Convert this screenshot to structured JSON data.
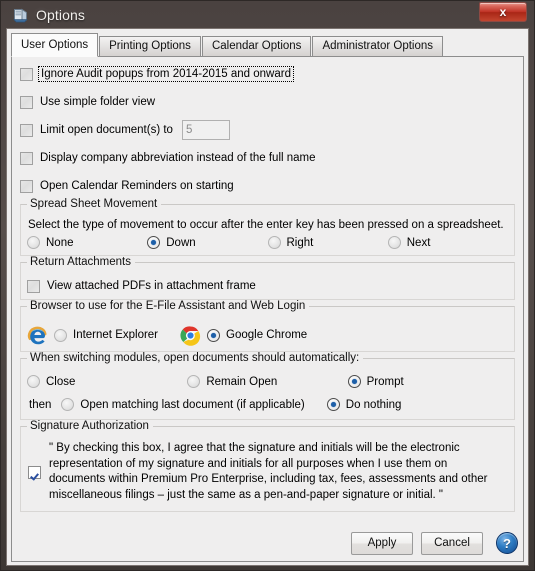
{
  "window": {
    "title": "Options",
    "title_icon": "options-document-icon",
    "close_label": "x",
    "frame_color": "#574e4b",
    "client_bg": "#efeeee"
  },
  "tabs": [
    {
      "label": "User Options",
      "active": true
    },
    {
      "label": "Printing Options",
      "active": false
    },
    {
      "label": "Calendar Options",
      "active": false
    },
    {
      "label": "Administrator Options",
      "active": false
    }
  ],
  "checkboxes": [
    {
      "label": "Ignore Audit popups from 2014-2015 and onward",
      "checked": false,
      "focused": true
    },
    {
      "label": "Use simple folder view",
      "checked": false,
      "focused": false
    },
    {
      "label": "Limit open document(s) to",
      "checked": false,
      "focused": false,
      "input_value": "5"
    },
    {
      "label": "Display company abbreviation instead of the full name",
      "checked": false,
      "focused": false
    },
    {
      "label": "Open Calendar Reminders on starting",
      "checked": false,
      "focused": false
    }
  ],
  "spreadsheet_group": {
    "title": "Spread Sheet Movement",
    "description": "Select the type of movement to occur after the enter key has been pressed on a spreadsheet.",
    "options": [
      {
        "label": "None",
        "selected": false
      },
      {
        "label": "Down",
        "selected": true
      },
      {
        "label": "Right",
        "selected": false
      },
      {
        "label": "Next",
        "selected": false
      }
    ]
  },
  "return_attachments_group": {
    "title": "Return Attachments",
    "checkbox": {
      "label": "View attached PDFs in attachment frame",
      "checked": false
    }
  },
  "browser_group": {
    "title": "Browser to use for the E-File Assistant and Web Login",
    "options": [
      {
        "label": "Internet Explorer",
        "selected": false,
        "icon": "internet-explorer-icon"
      },
      {
        "label": "Google Chrome",
        "selected": true,
        "icon": "google-chrome-icon"
      }
    ]
  },
  "switching_group": {
    "title": "When switching modules, open documents should automatically:",
    "options": [
      {
        "label": "Close",
        "selected": false
      },
      {
        "label": "Remain Open",
        "selected": false
      },
      {
        "label": "Prompt",
        "selected": true
      }
    ],
    "then_label": "then",
    "then_options": [
      {
        "label": "Open matching last document (if applicable)",
        "selected": false
      },
      {
        "label": "Do nothing",
        "selected": true
      }
    ]
  },
  "signature_group": {
    "title": "Signature Authorization",
    "checked": true,
    "text": "\" By checking this box, I agree that the signature and initials will be the electronic representation of my signature and initials for all purposes when I use them on documents within Premium Pro Enterprise, including tax, fees, assessments and other miscellaneous filings – just the same as a pen-and-paper signature or initial. \""
  },
  "footer": {
    "apply_label": "Apply",
    "cancel_label": "Cancel",
    "help_label": "?"
  }
}
